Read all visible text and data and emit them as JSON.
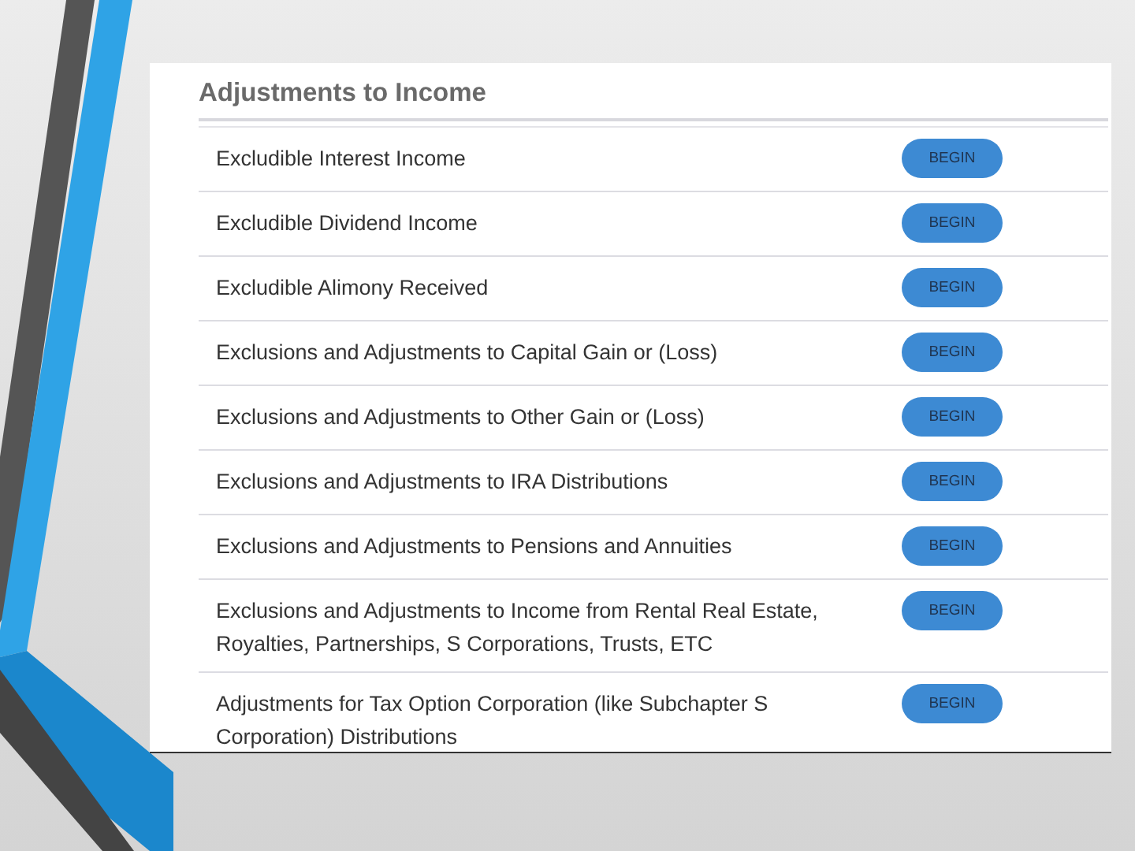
{
  "panel": {
    "title": "Adjustments to Income",
    "items": [
      {
        "label": "Excludible Interest Income",
        "button": "BEGIN"
      },
      {
        "label": "Excludible Dividend Income",
        "button": "BEGIN"
      },
      {
        "label": "Excludible Alimony Received",
        "button": "BEGIN"
      },
      {
        "label": "Exclusions and Adjustments to Capital Gain or (Loss)",
        "button": "BEGIN"
      },
      {
        "label": "Exclusions and Adjustments to Other Gain or (Loss)",
        "button": "BEGIN"
      },
      {
        "label": "Exclusions and Adjustments to IRA Distributions",
        "button": "BEGIN"
      },
      {
        "label": "Exclusions and Adjustments to Pensions and Annuities",
        "button": "BEGIN"
      },
      {
        "label": "Exclusions and Adjustments to Income from Rental Real Estate, Royalties, Partnerships, S Corporations, Trusts, ETC",
        "button": "BEGIN"
      },
      {
        "label": "Adjustments for Tax Option Corporation (like Subchapter S Corporation) Distributions",
        "button": "BEGIN"
      }
    ]
  }
}
